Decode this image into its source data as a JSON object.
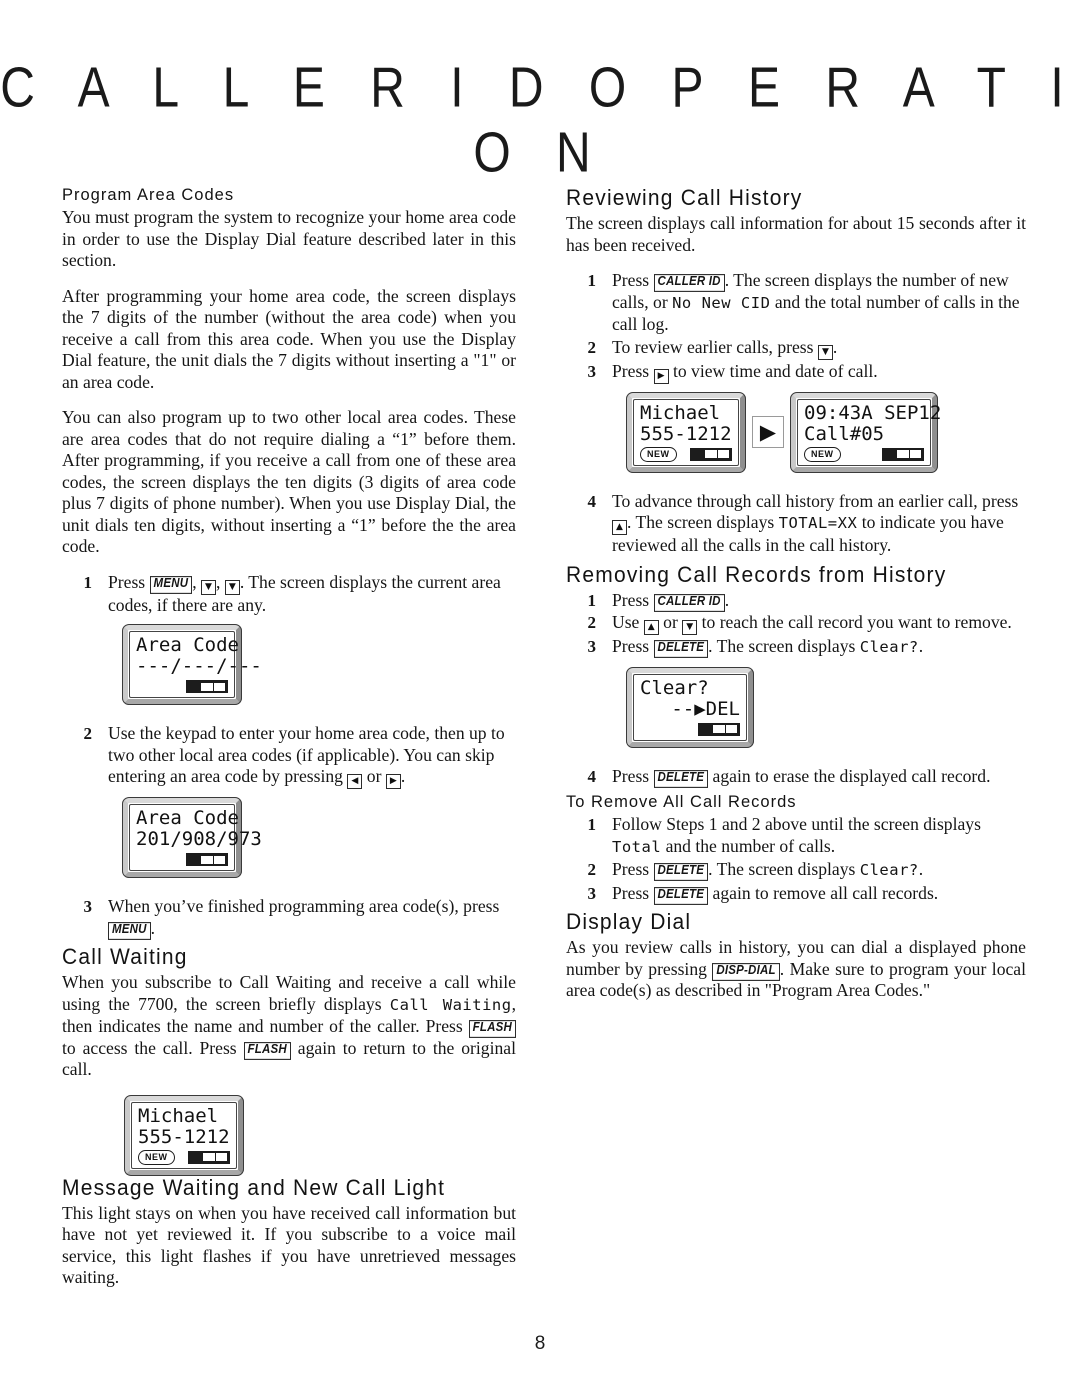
{
  "page": {
    "title": "C A L L E R   I D   O P E R A T I O N",
    "number": "8"
  },
  "left_column": {
    "program_area_codes": {
      "heading": "Program Area Codes",
      "para1": "You must program the system to recognize your home area code in order to use the Display Dial feature described later in this section.",
      "para2": "After programming your home area code, the screen displays the 7 digits of the number (without the area code) when you receive a call from this area code.  When you use the Display Dial feature, the unit dials the 7 digits without inserting a \"1\" or an area code.",
      "para3": "You can also program up to two other local area codes.  These are area codes that do not require dialing a “1” before them.  After programming, if you receive a call from one of these area codes, the screen displays the ten digits (3 digits of area code plus 7 digits of phone number). When you use Display Dial, the unit dials ten digits, without inserting a “1” before the the area code.",
      "steps": [
        {
          "num": "1",
          "pre": "Press ",
          "key1": "MENU",
          "mid1": ", ",
          "arrow1": "▼",
          "mid2": ", ",
          "arrow2": "▼",
          "post": ".  The screen displays the current area codes, if there are any."
        },
        {
          "num": "2",
          "pre": "Use the keypad to enter your home area code, then up to two other local area codes (if applicable).  You can skip entering an area code by pressing ",
          "arrow1": "◀",
          "mid1": " or ",
          "arrow2": "▶",
          "post": "."
        },
        {
          "num": "3",
          "pre": "When you’ve finished  programming area code(s), press ",
          "key1": "MENU",
          "post": "."
        }
      ],
      "lcd1": {
        "line1": "Area Code",
        "line2": "---/---/---",
        "new_badge": ""
      },
      "lcd2": {
        "line1": "Area Code",
        "line2": "201/908/973",
        "new_badge": ""
      }
    },
    "call_waiting": {
      "heading": "Call Waiting",
      "text_a": "When you subscribe to Call Waiting and receive a call while using the 7700, the screen briefly displays ",
      "lcd_phrase": "Call Waiting",
      "text_b": ", then indicates the name and number of the caller.  Press ",
      "key1": "FLASH",
      "text_c": " to access the call.  Press ",
      "key2": "FLASH",
      "text_d": " again to return to the original call.",
      "lcd": {
        "line1": "Michael",
        "line2": "555-1212",
        "new_badge": "NEW"
      }
    },
    "message_waiting": {
      "heading": "Message Waiting and New Call Light",
      "text": "This light stays on when you have received call information but have not yet reviewed it.  If you subscribe to a voice mail service, this light flashes if you have unretrieved messages waiting."
    }
  },
  "right_column": {
    "reviewing_call_history": {
      "heading": "Reviewing Call History",
      "intro": "The screen displays call information for about 15 seconds after it has been received.",
      "steps": [
        {
          "num": "1",
          "pre": "Press ",
          "key1": "CALLER ID",
          "mid1": ".  The screen displays the number of new calls, or ",
          "lcd_phrase": "No New CID",
          "post": " and the total number of calls in the call log."
        },
        {
          "num": "2",
          "pre": "To review earlier calls, press ",
          "arrow1": "▼",
          "post": "."
        },
        {
          "num": "3",
          "pre": "Press ",
          "arrow1": "▶",
          "post": " to view time and date of call."
        },
        {
          "num": "4",
          "pre": "To advance through call history from an earlier call, press ",
          "arrow1": "▲",
          "mid1": ".  The screen displays ",
          "lcd_phrase": "TOTAL=XX",
          "post": " to indicate you have reviewed all the calls in the call history."
        }
      ],
      "lcd_left": {
        "line1": "Michael",
        "line2": "555-1212",
        "new_badge": "NEW"
      },
      "transition_icon": "▶",
      "lcd_right": {
        "line1": "09:43A SEP12",
        "line2": "Call#05",
        "new_badge": "NEW"
      }
    },
    "removing_call_records": {
      "heading": "Removing Call Records from History",
      "steps": [
        {
          "num": "1",
          "pre": "Press ",
          "key1": "CALLER ID",
          "post": "."
        },
        {
          "num": "2",
          "pre": "Use ",
          "arrow1": "▲",
          "mid1": " or ",
          "arrow2": "▼",
          "post": " to reach the call record you want to remove."
        },
        {
          "num": "3",
          "pre": "Press ",
          "key1": "DELETE",
          "mid1": ". The screen displays ",
          "lcd_phrase": "Clear?",
          "post": "."
        },
        {
          "num": "4",
          "pre": "Press ",
          "key1": "DELETE",
          "post": " again to erase the displayed call record."
        }
      ],
      "lcd": {
        "line1": "Clear?",
        "line2": "--▶DEL",
        "new_badge": ""
      }
    },
    "remove_all_records": {
      "heading": "To Remove All Call Records",
      "steps": [
        {
          "num": "1",
          "pre": "Follow Steps 1 and 2 above until the screen displays ",
          "lcd_phrase": "Total",
          "post": " and the number of calls."
        },
        {
          "num": "2",
          "pre": "Press ",
          "key1": "DELETE",
          "mid1": ".  The screen displays ",
          "lcd_phrase": "Clear?",
          "post": "."
        },
        {
          "num": "3",
          "pre": "Press ",
          "key1": "DELETE",
          "post": " again to remove all call records."
        }
      ]
    },
    "display_dial": {
      "heading": "Display Dial",
      "text_a": "As you review calls in history, you can dial a displayed phone number by pressing ",
      "key1": "DISP-DIAL",
      "text_b": ".  Make sure to program your local area code(s) as described in \"Program Area Codes.\""
    }
  }
}
